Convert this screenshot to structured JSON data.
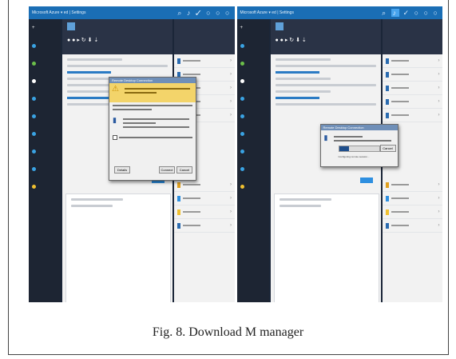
{
  "caption": "Fig. 8.   Download M manager",
  "panels": [
    {
      "topbar_title": "Microsoft Azure  ▾  ed  |  Settings",
      "dialog_title": "Remote Desktop Connection",
      "dialog_warning": "The publisher of this remote connection cannot be identified. Do you want to connect anyway?",
      "buttons": [
        "Details",
        "Connect",
        "Cancel"
      ]
    },
    {
      "topbar_title": "Microsoft Azure  ▾  ed  |  Settings",
      "dialog_title": "Remote Desktop Connection",
      "dialog_status": "Configuring remote session...",
      "progress_fraction": 0.25,
      "buttons": [
        "Cancel"
      ]
    }
  ],
  "colors": {
    "azure_blue": "#1a6eb5",
    "nav_dark": "#1d2533",
    "warning_yellow": "#f3d46a",
    "progress_fill": "#1e4e8c"
  }
}
